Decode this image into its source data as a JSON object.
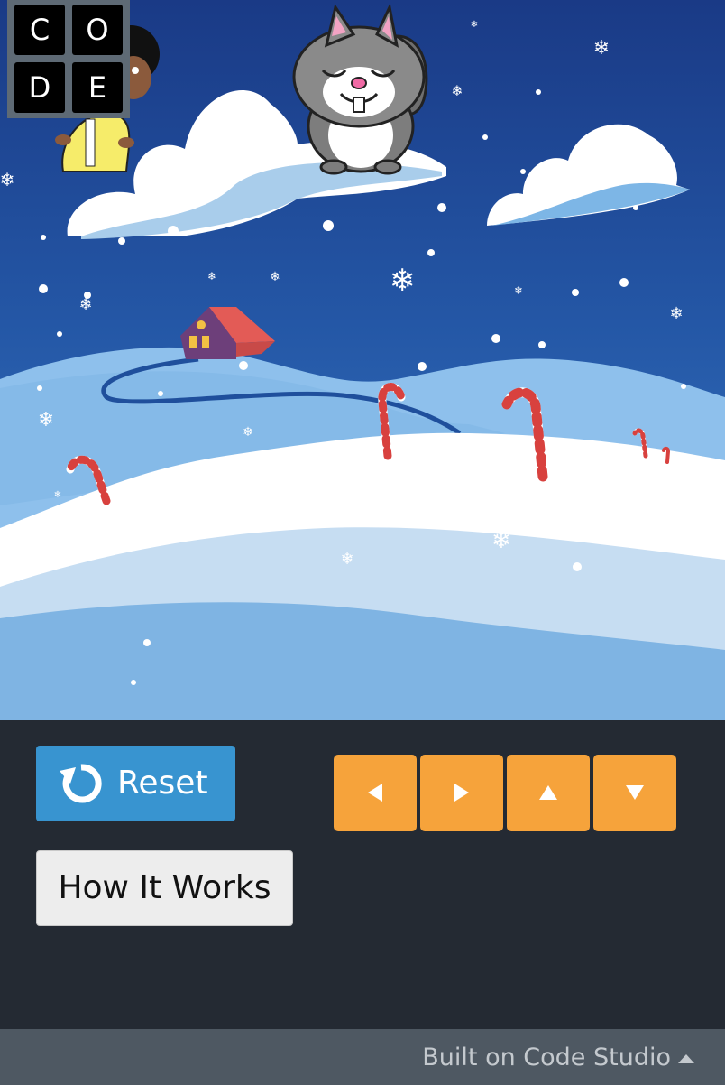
{
  "logo": {
    "letters": [
      "C",
      "O",
      "D",
      "E"
    ]
  },
  "controls": {
    "reset_label": "Reset",
    "how_it_works_label": "How It Works",
    "arrows": [
      "left-arrow-icon",
      "right-arrow-icon",
      "up-arrow-icon",
      "down-arrow-icon"
    ]
  },
  "footer": {
    "text": "Built on Code Studio"
  },
  "colors": {
    "sky": "#1d3f8a",
    "reset": "#3894d0",
    "arrow_buttons": "#f6a33b",
    "panel": "#242a33",
    "footer": "#4e5862"
  }
}
